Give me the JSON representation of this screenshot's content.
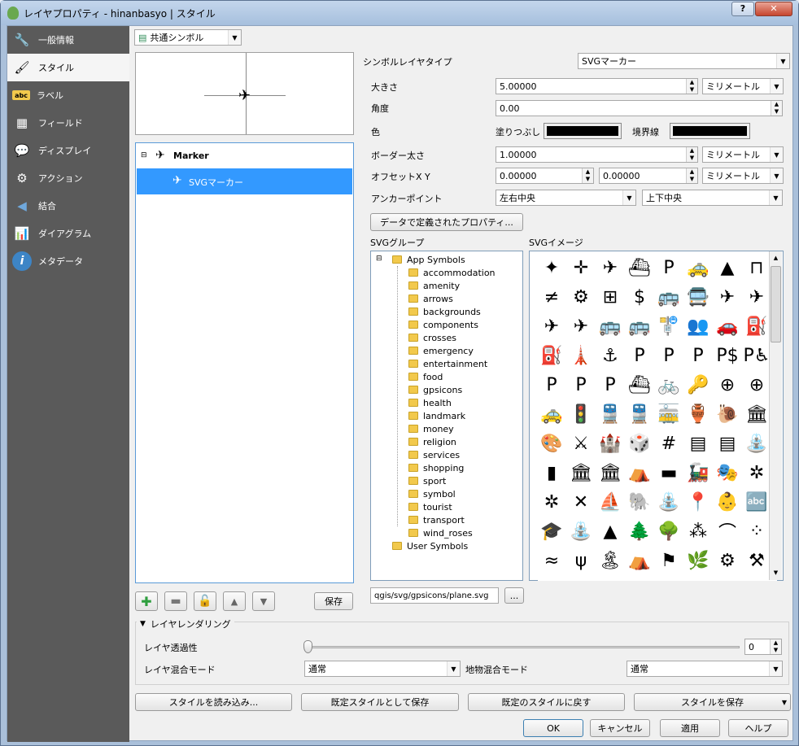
{
  "window": {
    "title": "レイヤプロパティ - hinanbasyo | スタイル",
    "help_label": "?",
    "close_label": "✕"
  },
  "sidebar": {
    "items": [
      {
        "label": "一般情報",
        "icon": "wrench-icon"
      },
      {
        "label": "スタイル",
        "icon": "paintbrush-icon"
      },
      {
        "label": "ラベル",
        "icon": "abc-icon"
      },
      {
        "label": "フィールド",
        "icon": "table-icon"
      },
      {
        "label": "ディスプレイ",
        "icon": "speech-bubble-icon"
      },
      {
        "label": "アクション",
        "icon": "gear-icon"
      },
      {
        "label": "結合",
        "icon": "join-icon"
      },
      {
        "label": "ダイアグラム",
        "icon": "diagram-icon"
      },
      {
        "label": "メタデータ",
        "icon": "info-icon"
      }
    ],
    "active_index": 1
  },
  "renderer": {
    "selected": "共通シンボル"
  },
  "symbol_tree": {
    "root": "Marker",
    "child": "SVGマーカー"
  },
  "props": {
    "layer_type_label": "シンボルレイヤタイプ",
    "layer_type_value": "SVGマーカー",
    "size_label": "大きさ",
    "size_value": "5.00000",
    "size_unit": "ミリメートル",
    "angle_label": "角度",
    "angle_value": "0.00",
    "color_label": "色",
    "fill_label": "塗りつぶし",
    "border_label": "境界線",
    "fill_color": "#000000",
    "border_color": "#000000",
    "border_width_label": "ボーダー太さ",
    "border_width_value": "1.00000",
    "border_width_unit": "ミリメートル",
    "offset_label": "オフセットX Y",
    "offset_x": "0.00000",
    "offset_y": "0.00000",
    "offset_unit": "ミリメートル",
    "anchor_label": "アンカーポイント",
    "anchor_h": "左右中央",
    "anchor_v": "上下中央",
    "data_defined_button": "データで定義されたプロパティ..."
  },
  "svg_groups": {
    "label": "SVGグループ",
    "root": "App Symbols",
    "children": [
      "accommodation",
      "amenity",
      "arrows",
      "backgrounds",
      "components",
      "crosses",
      "emergency",
      "entertainment",
      "food",
      "gpsicons",
      "health",
      "landmark",
      "money",
      "religion",
      "services",
      "shopping",
      "sport",
      "symbol",
      "tourist",
      "transport",
      "wind_roses"
    ],
    "user": "User Symbols"
  },
  "svg_images": {
    "label": "SVGイメージ",
    "rows": [
      [
        "✦",
        "✛",
        "✈",
        "⛴",
        "P",
        "🚕",
        "▲",
        "⊓"
      ],
      [
        "≠",
        "⚙",
        "⊞",
        "$",
        "🚌",
        "🚍",
        "✈",
        "✈"
      ],
      [
        "✈",
        "✈",
        "🚌",
        "🚌",
        "🚏",
        "👥",
        "🚗",
        "⛽"
      ],
      [
        "⛽",
        "🗼",
        "⚓",
        "P",
        "P",
        "P",
        "P$",
        "P♿"
      ],
      [
        "P",
        "P",
        "P",
        "⛴",
        "🚲",
        "🔑",
        "⊕",
        "⊕"
      ],
      [
        "🚕",
        "🚦",
        "🚆",
        "🚆",
        "🚋",
        "🏺",
        "🐌",
        "🏛"
      ],
      [
        "🎨",
        "⚔",
        "🏰",
        "🎲",
        "#",
        "▤",
        "▤",
        "⛲"
      ],
      [
        "▮",
        "🏛",
        "🏛",
        "⛺",
        "▬",
        "🚂",
        "🎭",
        "✲"
      ],
      [
        "✲",
        "✕",
        "⛵",
        "🐘",
        "⛲",
        "📍",
        "👶",
        "🔤"
      ],
      [
        "🎓",
        "⛲",
        "▲",
        "🌲",
        "🌳",
        "⁂",
        "⌒",
        "⁘"
      ],
      [
        "≈",
        "ψ",
        "🏝",
        "⛺",
        "⚑",
        "🌿",
        "⚙",
        "⚒"
      ]
    ]
  },
  "svg_path": {
    "value": "qgis/svg/gpsicons/plane.svg",
    "browse_label": "..."
  },
  "list_buttons": {
    "save_label": "保存"
  },
  "layer_rendering": {
    "section_label": "レイヤレンダリング",
    "transparency_label": "レイヤ透過性",
    "transparency_value": "0",
    "blend_label": "レイヤ混合モード",
    "blend_value": "通常",
    "feature_blend_label": "地物混合モード",
    "feature_blend_value": "通常"
  },
  "style_buttons": {
    "load": "スタイルを読み込み...",
    "save_default": "既定スタイルとして保存",
    "restore_default": "既定のスタイルに戻す",
    "save_style": "スタイルを保存"
  },
  "dialog_buttons": {
    "ok": "OK",
    "cancel": "キャンセル",
    "apply": "適用",
    "help": "ヘルプ"
  }
}
